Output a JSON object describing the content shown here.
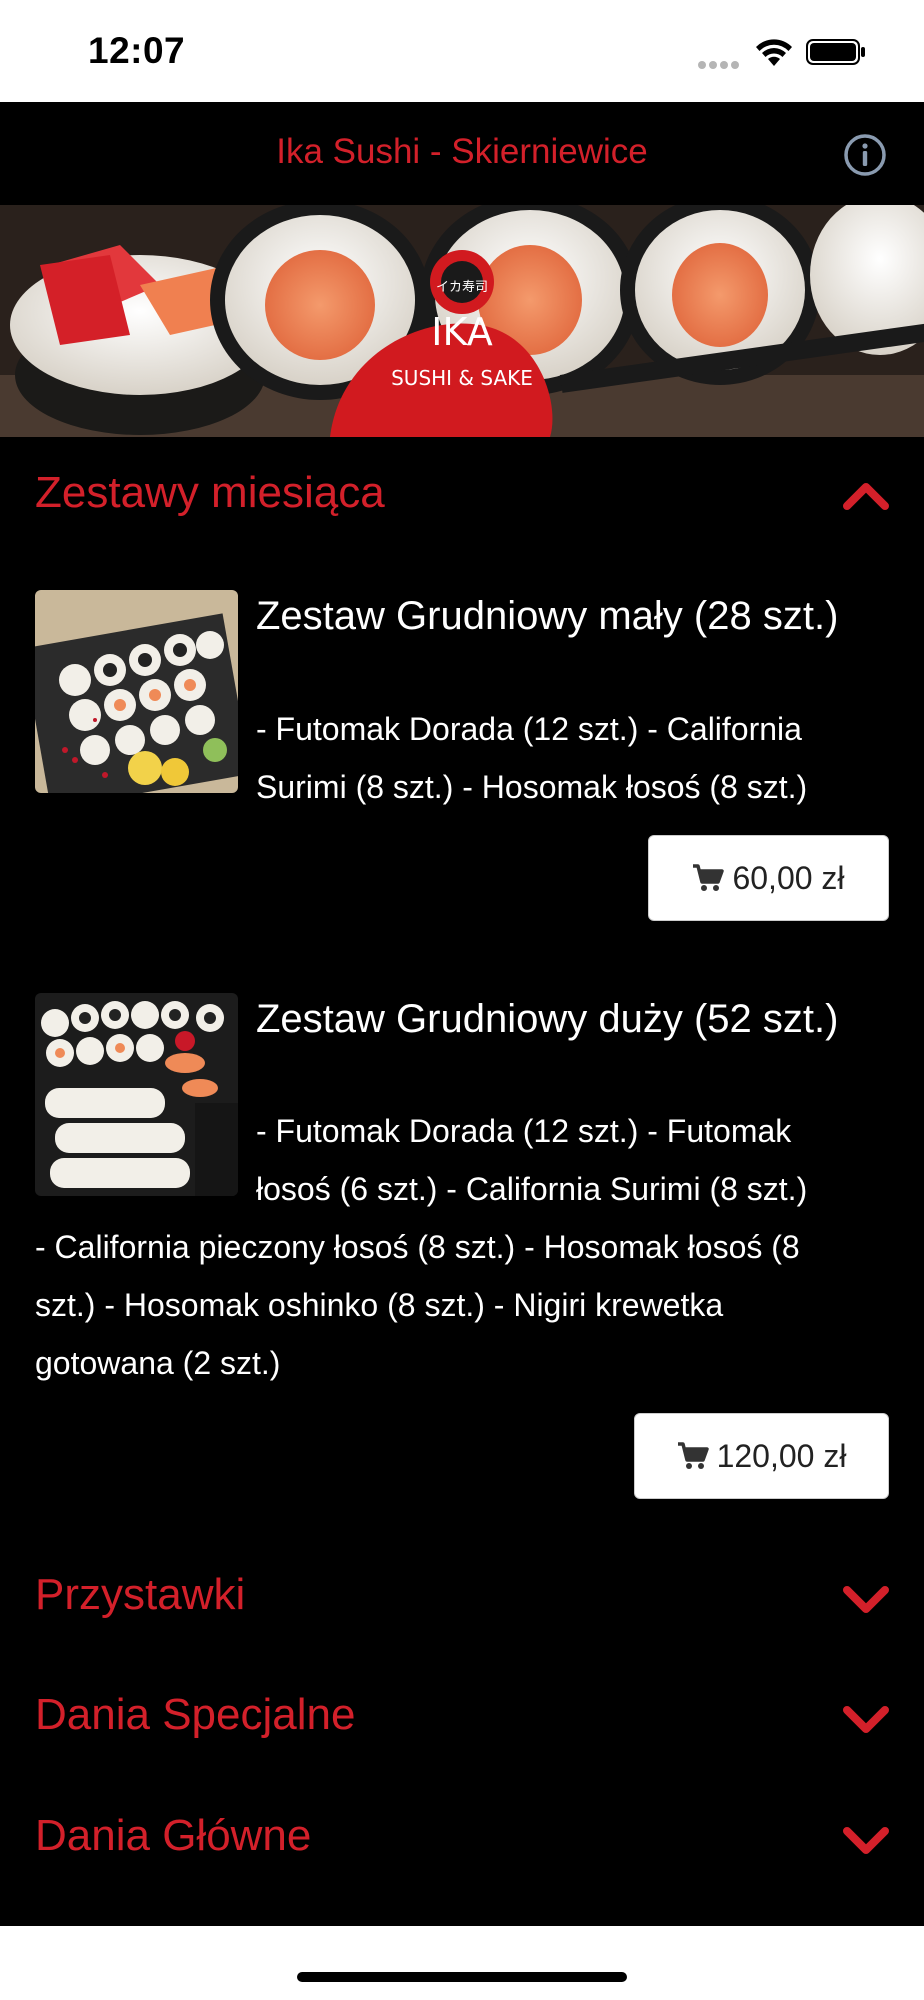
{
  "status_bar": {
    "time": "12:07"
  },
  "header": {
    "title": "Ika Sushi - Skierniewice",
    "info_icon": "info-circle-icon"
  },
  "banner": {
    "logo_text": "IKA",
    "logo_subtext": "SUSHI & SAKE",
    "logo_kanji": "イカ寿司"
  },
  "sections": [
    {
      "title": "Zestawy miesiąca",
      "expanded": true,
      "items": [
        {
          "name": "Zestaw Grudniowy mały (28 szt.)",
          "desc_line1": "- Futomak Dorada (12 szt.) - California",
          "desc_line2": "Surimi (8 szt.) - Hosomak łosoś (8 szt.)",
          "price": "60,00 zł"
        },
        {
          "name": "Zestaw Grudniowy duży (52 szt.)",
          "desc_line1": "- Futomak Dorada (12 szt.) - Futomak",
          "desc_line2": "łosoś (6 szt.) - California Surimi (8 szt.)",
          "desc_line3": "- California pieczony łosoś (8 szt.) - Hosomak łosoś (8",
          "desc_line4": "szt.) - Hosomak oshinko (8 szt.) - Nigiri krewetka",
          "desc_line5": "gotowana (2 szt.)",
          "price": "120,00 zł"
        }
      ]
    },
    {
      "title": "Przystawki",
      "expanded": false
    },
    {
      "title": "Dania Specjalne",
      "expanded": false
    },
    {
      "title": "Dania Główne",
      "expanded": false
    }
  ],
  "colors": {
    "accent": "#d3202a",
    "background": "#000000",
    "text": "#ffffff"
  }
}
